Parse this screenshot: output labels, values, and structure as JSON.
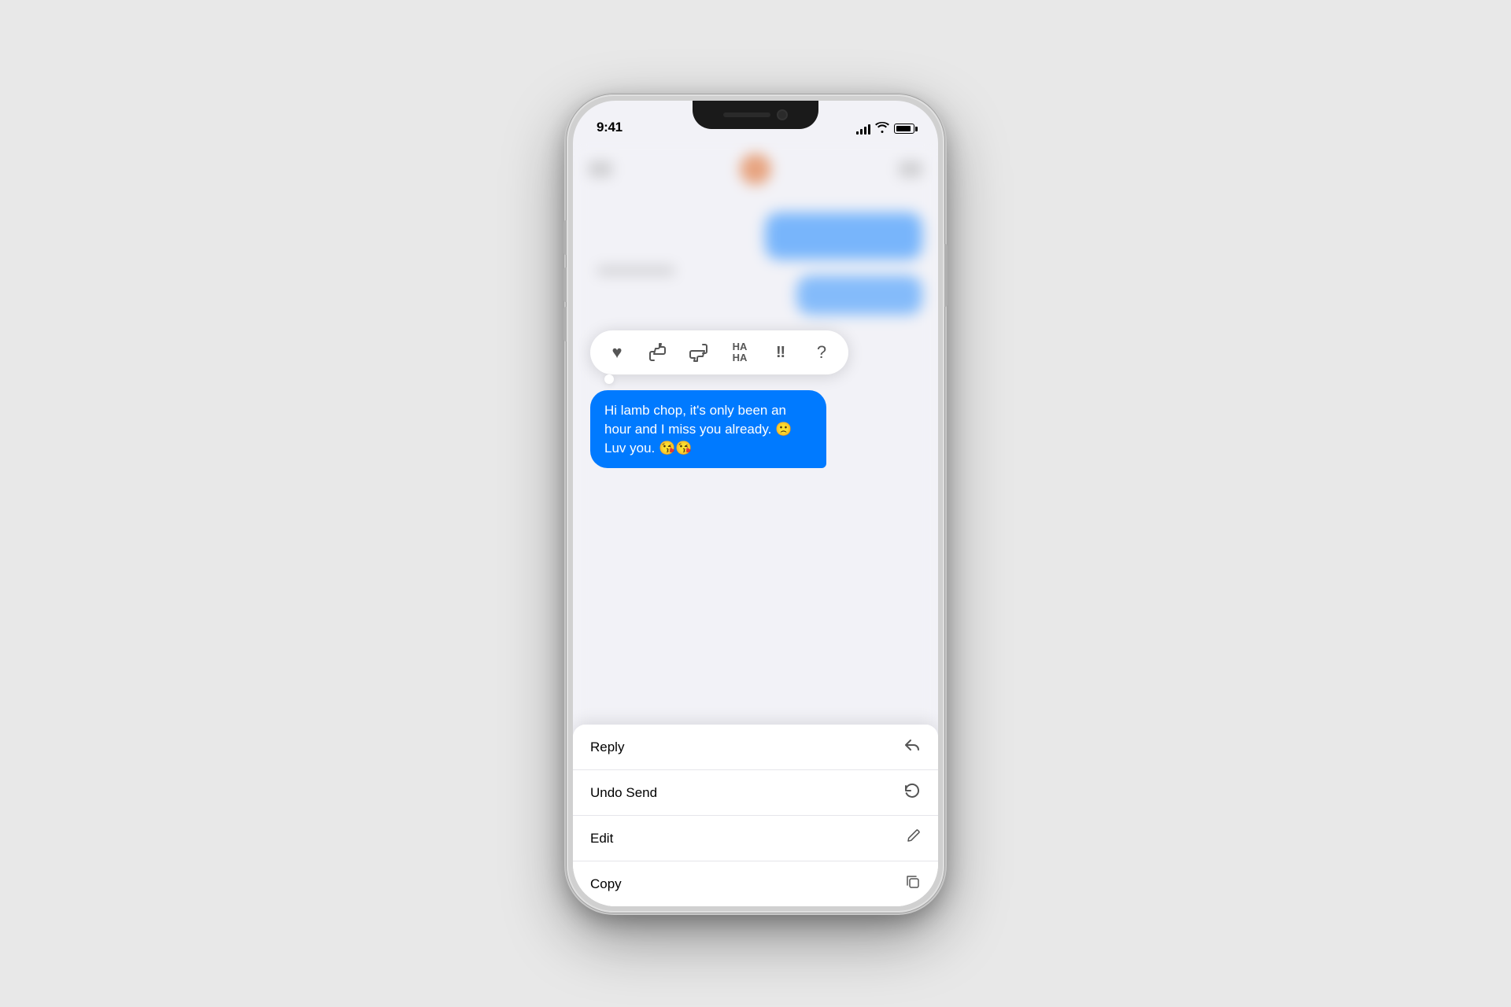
{
  "scene": {
    "background_color": "#e8e8e8"
  },
  "status_bar": {
    "time": "9:41",
    "signal_bars": [
      3,
      6,
      9,
      12,
      14
    ],
    "wifi": "wifi",
    "battery": "battery"
  },
  "tapback": {
    "reactions": [
      {
        "name": "heart",
        "symbol": "♥",
        "active": false
      },
      {
        "name": "thumbs-up",
        "symbol": "👍",
        "active": false
      },
      {
        "name": "thumbs-down",
        "symbol": "👎",
        "active": false
      },
      {
        "name": "haha",
        "symbol": "HA\nHA",
        "active": false
      },
      {
        "name": "exclaim",
        "symbol": "‼",
        "active": false
      },
      {
        "name": "question",
        "symbol": "?",
        "active": false
      }
    ]
  },
  "message": {
    "text": "Hi lamb chop, it's only been an hour and I miss you already. 🙁 Luv you. 😘😘"
  },
  "context_menu": {
    "items": [
      {
        "label": "Reply",
        "icon": "↩",
        "id": "reply"
      },
      {
        "label": "Undo Send",
        "icon": "↩",
        "id": "undo-send"
      },
      {
        "label": "Edit",
        "icon": "✎",
        "id": "edit"
      },
      {
        "label": "Copy",
        "icon": "⧉",
        "id": "copy"
      }
    ]
  }
}
